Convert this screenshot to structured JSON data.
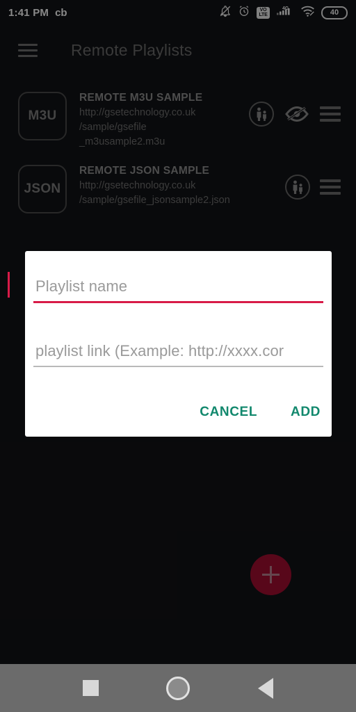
{
  "status_bar": {
    "time": "1:41 PM",
    "carrier_label": "cb",
    "icons": [
      "bell-off-icon",
      "alarm-icon",
      "volte-icon",
      "signal-4g-icon",
      "wifi-icon"
    ],
    "volte_top": "VO",
    "volte_bottom": "LTE",
    "network_type": "4G",
    "battery_level": "40"
  },
  "app_bar": {
    "menu_icon": "hamburger-menu-icon",
    "title": "Remote Playlists"
  },
  "playlists": [
    {
      "badge": "M3U",
      "title": "REMOTE M3U SAMPLE",
      "url": "http://gsetechnology.co.uk\n/sample/gsefile\n_m3usample2.m3u",
      "has_parental_icon": true,
      "has_hidden_icon": true,
      "has_drag_handle": true
    },
    {
      "badge": "JSON",
      "title": "REMOTE JSON SAMPLE",
      "url": "http://gsetechnology.co.uk\n/sample/gsefile_jsonsample2.json",
      "has_parental_icon": true,
      "has_hidden_icon": false,
      "has_drag_handle": true
    }
  ],
  "fab": {
    "icon": "plus-icon",
    "color": "#a00d31"
  },
  "dialog": {
    "name_field": {
      "placeholder": "Playlist name",
      "value": "",
      "focused": true,
      "underline_color": "#d81b48"
    },
    "link_field": {
      "placeholder": "playlist link (Example: http://xxxx.cor",
      "value": "",
      "focused": false,
      "underline_color": "#b9b9b9"
    },
    "cancel_label": "CANCEL",
    "add_label": "ADD",
    "button_color": "#12886d"
  },
  "nav_bar": {
    "recents_icon": "square-recents-icon",
    "home_icon": "circle-home-icon",
    "back_icon": "triangle-back-icon"
  }
}
